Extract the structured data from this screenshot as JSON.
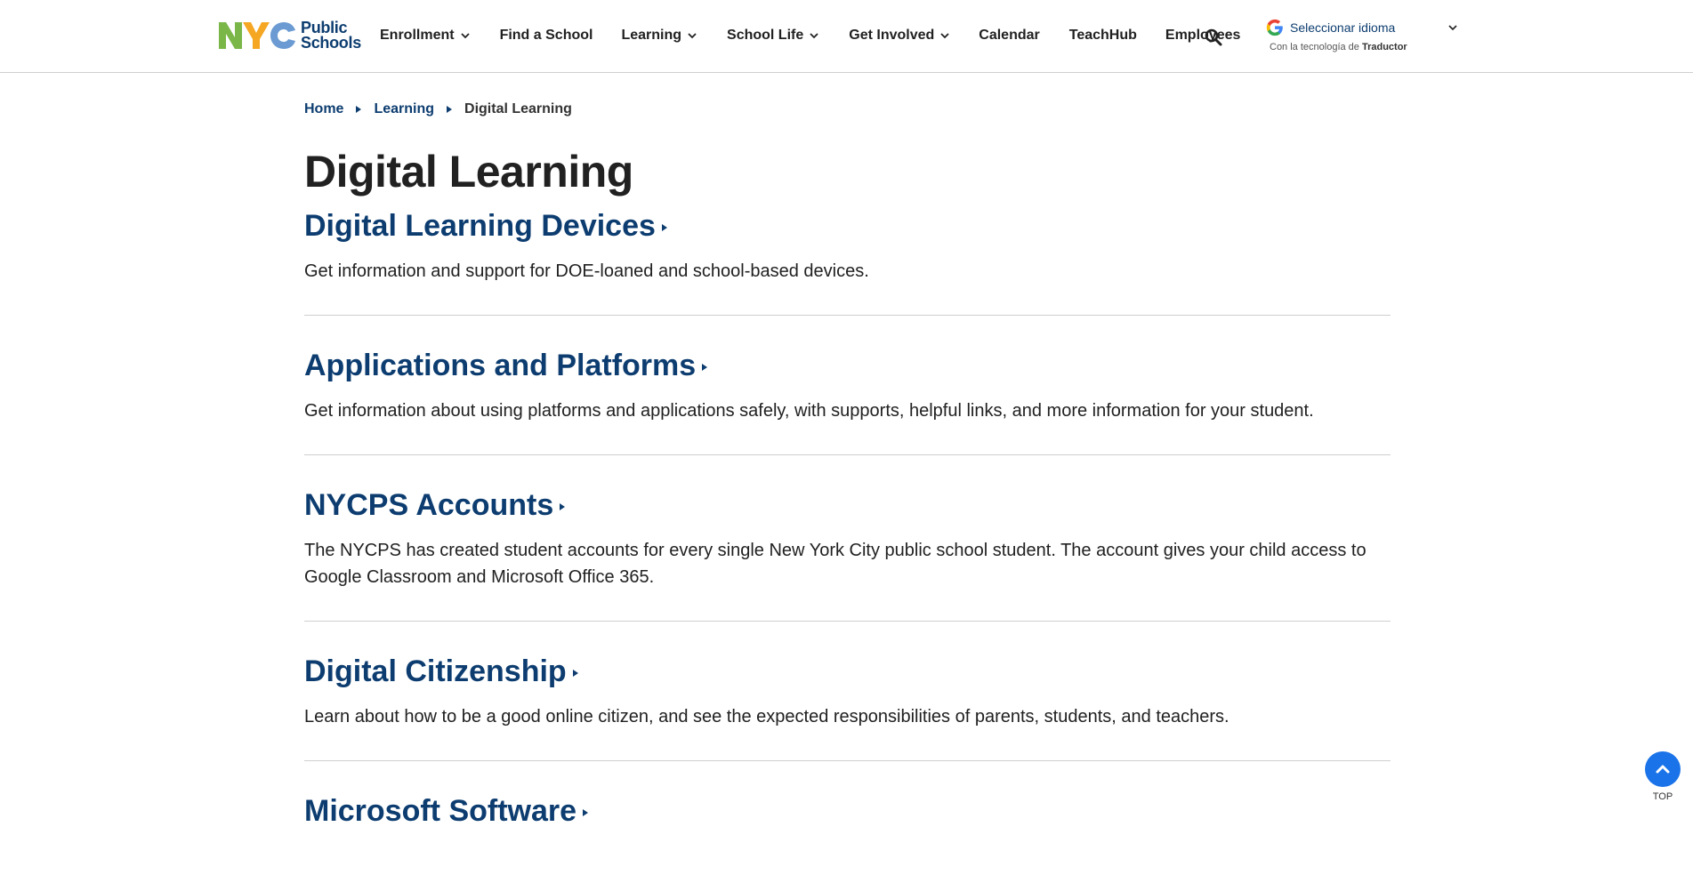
{
  "header": {
    "logo": {
      "nyc": "NYC",
      "line1": "Public",
      "line2": "Schools"
    },
    "nav": [
      {
        "label": "Enrollment",
        "dropdown": true
      },
      {
        "label": "Find a School",
        "dropdown": false
      },
      {
        "label": "Learning",
        "dropdown": true
      },
      {
        "label": "School Life",
        "dropdown": true
      },
      {
        "label": "Get Involved",
        "dropdown": true
      },
      {
        "label": "Calendar",
        "dropdown": false
      },
      {
        "label": "TeachHub",
        "dropdown": false
      },
      {
        "label": "Employees",
        "dropdown": false
      }
    ],
    "search_icon": "search-icon",
    "translate": {
      "label": "Seleccionar idioma",
      "powered_prefix": "Con la tecnología de",
      "powered_brand": "Traductor"
    }
  },
  "breadcrumb": [
    {
      "label": "Home",
      "link": true
    },
    {
      "label": "Learning",
      "link": true
    },
    {
      "label": "Digital Learning",
      "link": false
    }
  ],
  "page": {
    "title": "Digital Learning"
  },
  "sections": [
    {
      "title": "Digital Learning Devices",
      "description": "Get information and support for DOE-loaned and school-based devices."
    },
    {
      "title": "Applications and Platforms",
      "description": "Get information about using platforms and applications safely, with supports, helpful links, and more information for your student."
    },
    {
      "title": "NYCPS Accounts",
      "description": "The NYCPS has created student accounts for every single New York City public school student. The account gives your child access to Google Classroom and Microsoft Office 365."
    },
    {
      "title": "Digital Citizenship",
      "description": "Learn about how to be a good online citizen, and see the expected responsibilities of parents, students, and teachers."
    },
    {
      "title": "Microsoft Software",
      "description": ""
    }
  ],
  "back_to_top": {
    "label": "TOP"
  },
  "colors": {
    "brand_navy": "#0d3d70",
    "logo_green": "#7ab648",
    "logo_yellow": "#f5a623",
    "logo_blue": "#6b9bd2",
    "top_button": "#1a73e8",
    "divider": "#cfcfcf"
  }
}
